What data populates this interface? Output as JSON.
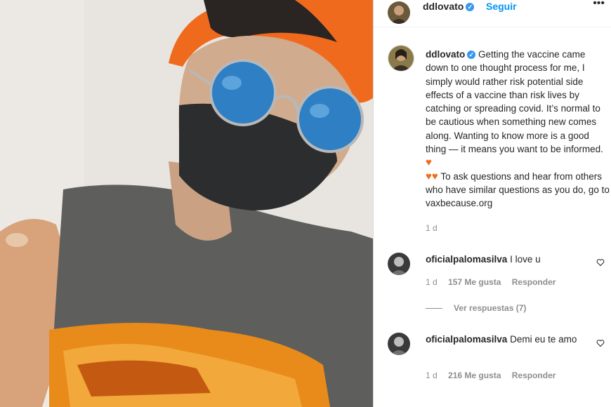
{
  "post": {
    "username": "ddlovato",
    "follow_label": "Seguir",
    "more_icon": "more-options-icon",
    "caption_parts": [
      "Getting the vaccine came down to one thought process for me, I simply would rather risk potential side effects of a vaccine than risk lives by catching or spreading covid. It’s normal to be cautious when something new comes along. Wanting to know more is a good thing — it means you want to be informed.",
      "To ask questions and hear from others who have similar questions as you do, go to vaxbecause.org"
    ],
    "emoji_icon": "orange-heart-icon",
    "time": "1 d"
  },
  "comments": [
    {
      "username": "oficialpalomasilva",
      "text": "I love u",
      "time": "1 d",
      "likes": "157 Me gusta",
      "reply_label": "Responder",
      "view_replies": "Ver respuestas (7)"
    },
    {
      "username": "oficialpalomasilva",
      "text": "Demi eu te amo",
      "time": "1 d",
      "likes": "216 Me gusta",
      "reply_label": "Responder"
    }
  ],
  "colors": {
    "link": "#0095f6",
    "verified": "#3897f0",
    "muted": "#8e8e8e",
    "heart": "#f26a1a"
  }
}
